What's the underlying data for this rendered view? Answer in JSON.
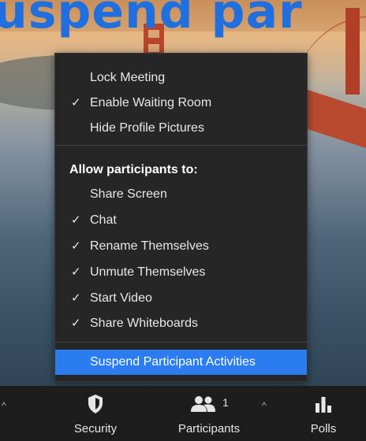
{
  "background": {
    "headline_text": "uspend par"
  },
  "menu": {
    "items": [
      {
        "label": "Lock Meeting",
        "checked": false
      },
      {
        "label": "Enable Waiting Room",
        "checked": true
      },
      {
        "label": "Hide Profile Pictures",
        "checked": false
      }
    ],
    "section_heading": "Allow participants to:",
    "allow_items": [
      {
        "label": "Share Screen",
        "checked": false
      },
      {
        "label": "Chat",
        "checked": true
      },
      {
        "label": "Rename Themselves",
        "checked": true
      },
      {
        "label": "Unmute Themselves",
        "checked": true
      },
      {
        "label": "Start Video",
        "checked": true
      },
      {
        "label": "Share Whiteboards",
        "checked": true
      }
    ],
    "action": {
      "label": "Suspend Participant Activities"
    },
    "check_glyph": "✓"
  },
  "toolbar": {
    "security_label": "Security",
    "participants_label": "Participants",
    "participants_count": "1",
    "polls_label": "Polls",
    "caret_glyph": "^",
    "accent_color": "#2b7cf0"
  }
}
